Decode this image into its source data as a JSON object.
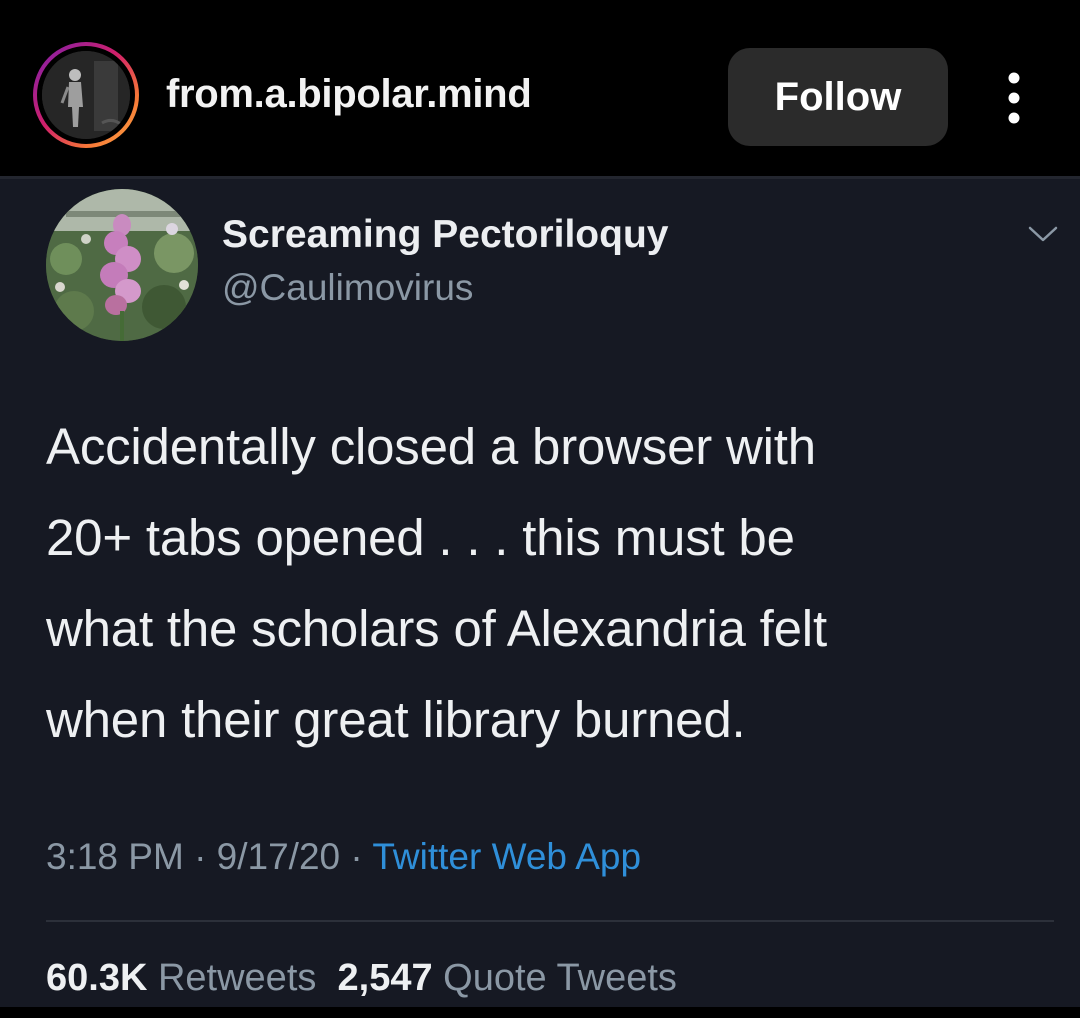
{
  "post": {
    "username": "from.a.bipolar.mind",
    "follow_label": "Follow",
    "more_icon": "more-vertical-icon"
  },
  "tweet": {
    "display_name": "Screaming Pectoriloquy",
    "handle": "@Caulimovirus",
    "text": "Accidentally closed a browser with\n20+ tabs opened . . . this must be\nwhat the scholars of Alexandria felt\nwhen their great library burned.",
    "time_date": "3:18 PM · 9/17/20 · ",
    "source": "Twitter Web App",
    "retweets_count": "60.3K",
    "retweets_label": "Retweets",
    "quotes_count": "2,547",
    "quotes_label": "Quote Tweets"
  },
  "colors": {
    "tweet_background": "#161923",
    "link_blue": "#2f8fd9",
    "secondary_text": "#8b98a5",
    "follow_button": "#2b2b2b"
  }
}
